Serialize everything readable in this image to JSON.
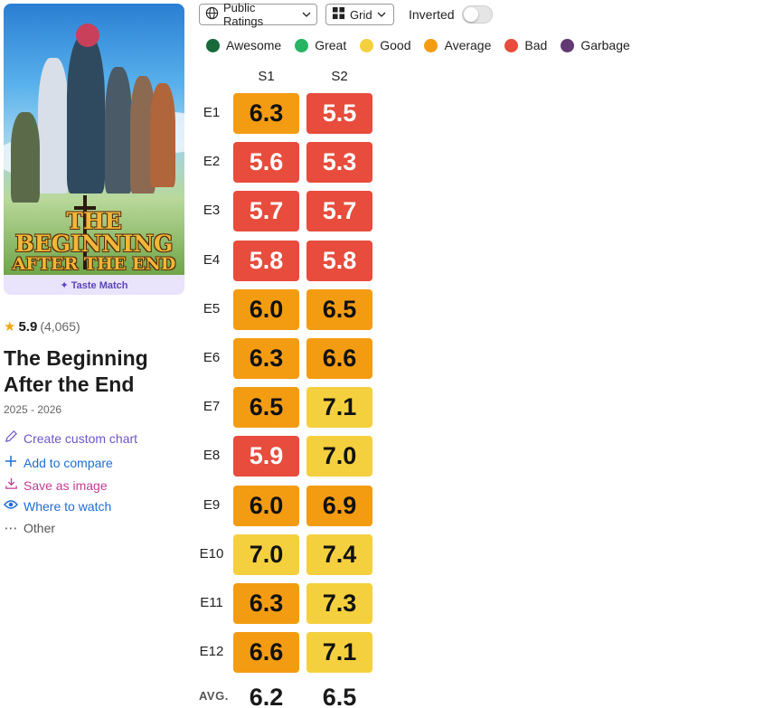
{
  "show": {
    "poster_title_line1": "THE BEGINNING",
    "poster_title_line2": "AFTER THE END",
    "taste_match": "✦ Taste Match",
    "rating": "5.9",
    "rating_count": "(4,065)",
    "title": "The Beginning After the End",
    "years": "2025 - 2026"
  },
  "actions": {
    "custom_chart": "Create custom chart",
    "compare": "Add to compare",
    "save": "Save as image",
    "watch": "Where to watch",
    "other": "Other"
  },
  "toolbar": {
    "ratings_label": "Public Ratings",
    "view_label": "Grid",
    "inverted_label": "Inverted",
    "inverted_on": false
  },
  "legend": [
    {
      "label": "Awesome",
      "color": "#186a3b"
    },
    {
      "label": "Great",
      "color": "#28b463"
    },
    {
      "label": "Good",
      "color": "#f4d03f"
    },
    {
      "label": "Average",
      "color": "#f39c12"
    },
    {
      "label": "Bad",
      "color": "#e74c3c"
    },
    {
      "label": "Garbage",
      "color": "#633974"
    }
  ],
  "grid": {
    "seasons": [
      "S1",
      "S2"
    ],
    "episodes": [
      "E1",
      "E2",
      "E3",
      "E4",
      "E5",
      "E6",
      "E7",
      "E8",
      "E9",
      "E10",
      "E11",
      "E12"
    ],
    "ratings": [
      [
        "6.3",
        "5.5"
      ],
      [
        "5.6",
        "5.3"
      ],
      [
        "5.7",
        "5.7"
      ],
      [
        "5.8",
        "5.8"
      ],
      [
        "6.0",
        "6.5"
      ],
      [
        "6.3",
        "6.6"
      ],
      [
        "6.5",
        "7.1"
      ],
      [
        "5.9",
        "7.0"
      ],
      [
        "6.0",
        "6.9"
      ],
      [
        "7.0",
        "7.4"
      ],
      [
        "6.3",
        "7.3"
      ],
      [
        "6.6",
        "7.1"
      ]
    ],
    "avg_label": "AVG.",
    "averages": [
      "6.2",
      "6.5"
    ]
  }
}
